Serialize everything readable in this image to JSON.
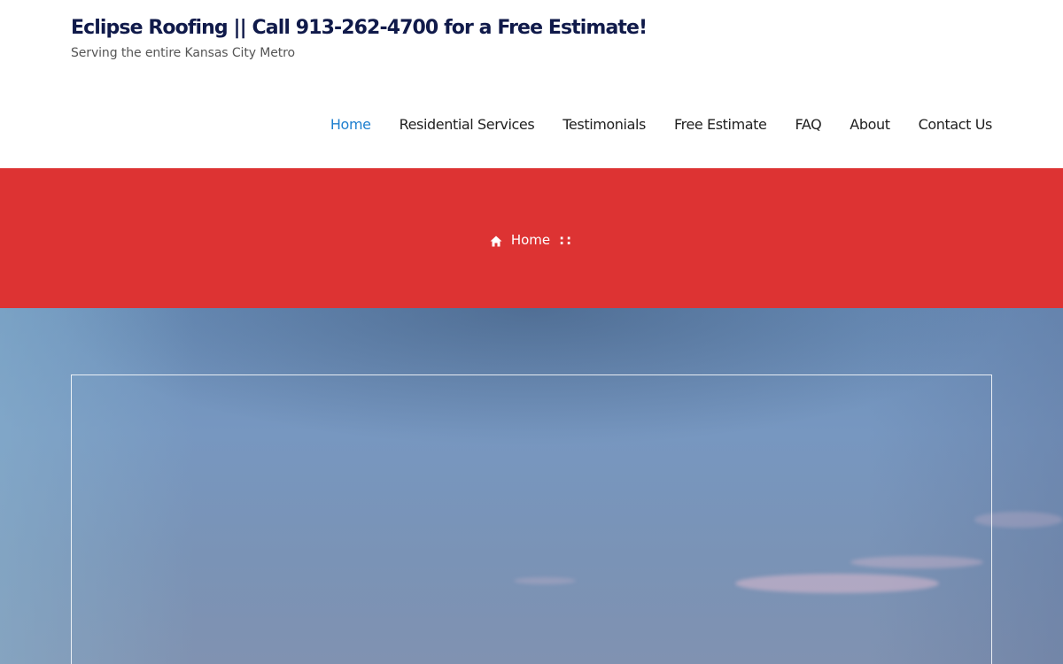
{
  "header": {
    "site_title": "Eclipse Roofing || Call 913-262-4700 for a Free Estimate!",
    "tagline": "Serving the entire Kansas City Metro"
  },
  "nav": {
    "items": [
      {
        "label": "Home",
        "active": true
      },
      {
        "label": "Residential Services"
      },
      {
        "label": "Testimonials"
      },
      {
        "label": "Free Estimate"
      },
      {
        "label": "FAQ"
      },
      {
        "label": "About"
      },
      {
        "label": "Contact Us"
      }
    ]
  },
  "banner": {
    "breadcrumb_home": "Home",
    "breadcrumb_separator": "::",
    "icon": "home-icon",
    "color": "#dd3333"
  },
  "colors": {
    "title": "#101a4a",
    "nav_active": "#1e7fcf",
    "nav_text": "#1f1f1f"
  }
}
